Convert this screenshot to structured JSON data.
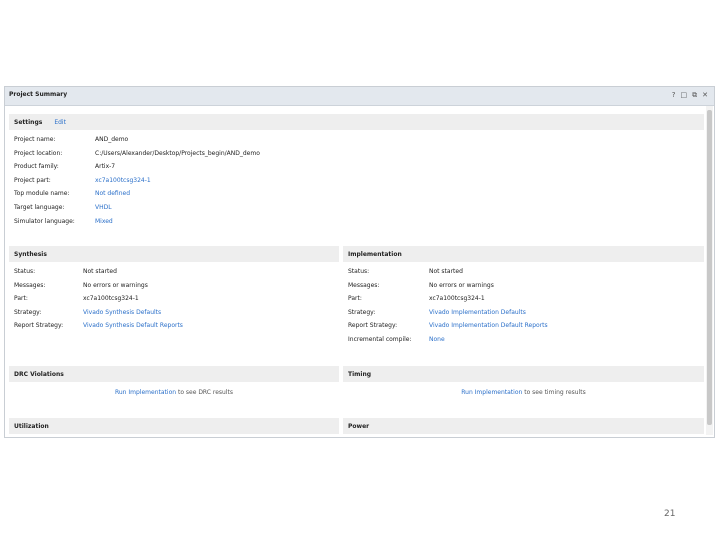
{
  "window": {
    "title": "Project Summary",
    "controls": [
      "?",
      "□",
      "⧉",
      "✕"
    ]
  },
  "settings": {
    "heading": "Settings",
    "edit_label": "Edit",
    "rows": [
      {
        "key": "Project name:",
        "value": "AND_demo",
        "link": false
      },
      {
        "key": "Project location:",
        "value": "C:/Users/Alexander/Desktop/Projects_begin/AND_demo",
        "link": false
      },
      {
        "key": "Product family:",
        "value": "Artix-7",
        "link": false
      },
      {
        "key": "Project part:",
        "value": "xc7a100tcsg324-1",
        "link": true
      },
      {
        "key": "Top module name:",
        "value": "Not defined",
        "link": true
      },
      {
        "key": "Target language:",
        "value": "VHDL",
        "link": true
      },
      {
        "key": "Simulator language:",
        "value": "Mixed",
        "link": true
      }
    ]
  },
  "synthesis": {
    "heading": "Synthesis",
    "rows": [
      {
        "key": "Status:",
        "value": "Not started",
        "link": false
      },
      {
        "key": "Messages:",
        "value": "No errors or warnings",
        "link": false
      },
      {
        "key": "Part:",
        "value": "xc7a100tcsg324-1",
        "link": false
      },
      {
        "key": "Strategy:",
        "value": "Vivado Synthesis Defaults",
        "link": true
      },
      {
        "key": "Report Strategy:",
        "value": "Vivado Synthesis Default Reports",
        "link": true
      }
    ]
  },
  "implementation": {
    "heading": "Implementation",
    "rows": [
      {
        "key": "Status:",
        "value": "Not started",
        "link": false
      },
      {
        "key": "Messages:",
        "value": "No errors or warnings",
        "link": false
      },
      {
        "key": "Part:",
        "value": "xc7a100tcsg324-1",
        "link": false
      },
      {
        "key": "Strategy:",
        "value": "Vivado Implementation Defaults",
        "link": true
      },
      {
        "key": "Report Strategy:",
        "value": "Vivado Implementation Default Reports",
        "link": true
      },
      {
        "key": "Incremental compile:",
        "value": "None",
        "link": true
      }
    ]
  },
  "drc": {
    "heading": "DRC Violations",
    "link": "Run Implementation",
    "text": "to see DRC results"
  },
  "timing": {
    "heading": "Timing",
    "link": "Run Implementation",
    "text": "to see timing results"
  },
  "utilization": {
    "heading": "Utilization"
  },
  "power": {
    "heading": "Power"
  },
  "page_number": "21"
}
